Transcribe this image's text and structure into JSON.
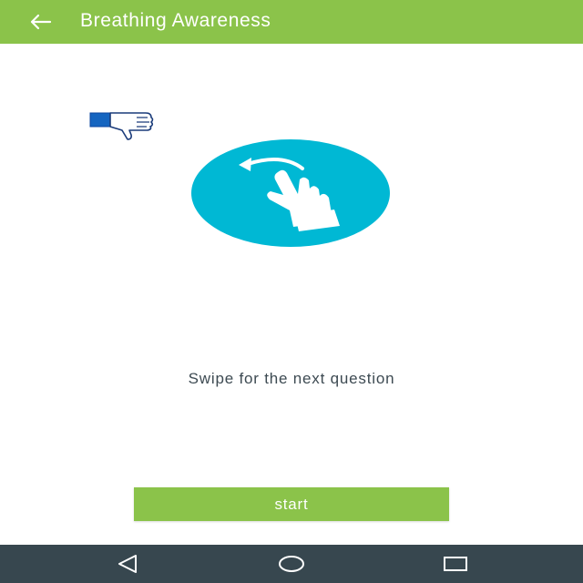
{
  "appbar": {
    "title": "Breathing Awareness",
    "back_icon": "arrow-left-icon",
    "color": "#8bc34a"
  },
  "main": {
    "feedback_icon": "thumbs-down-icon",
    "swipe_icon": "swipe-gesture-icon",
    "swipe_circle_color": "#00b8d4",
    "hint": "Swipe for the next question"
  },
  "start_button": {
    "label": "start",
    "color": "#8bc34a"
  },
  "navbar": {
    "color": "#37474f",
    "buttons": [
      "back-triangle-icon",
      "home-circle-icon",
      "recents-square-icon"
    ]
  }
}
